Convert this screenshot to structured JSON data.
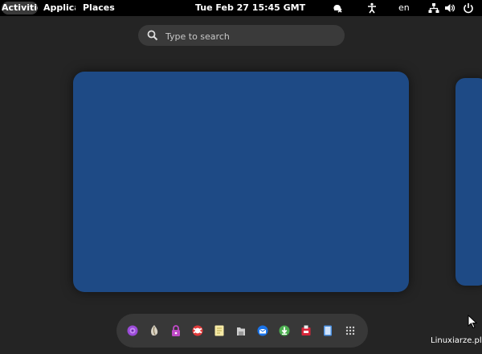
{
  "topbar": {
    "activities": "Activities",
    "applications": "Applications",
    "places": "Places",
    "clock": "Tue Feb 27  15:45 GMT",
    "language": "en",
    "indicators": [
      "screen-reader-icon",
      "accessibility-icon",
      "network-icon",
      "volume-icon",
      "power-icon"
    ]
  },
  "search": {
    "placeholder": "Type to search"
  },
  "dash": {
    "items": [
      "tor-browser-icon",
      "gimp-icon",
      "keepassxc-icon",
      "help-icon",
      "notes-icon",
      "files-icon",
      "thunderbird-icon",
      "software-icon",
      "tails-installer-icon",
      "text-editor-icon",
      "show-apps-icon"
    ]
  },
  "watermark": "Linuxiarze.pl",
  "colors": {
    "panel": "#000000",
    "background": "#242424",
    "workspace": "#1e4a85",
    "dash": "#383838"
  }
}
